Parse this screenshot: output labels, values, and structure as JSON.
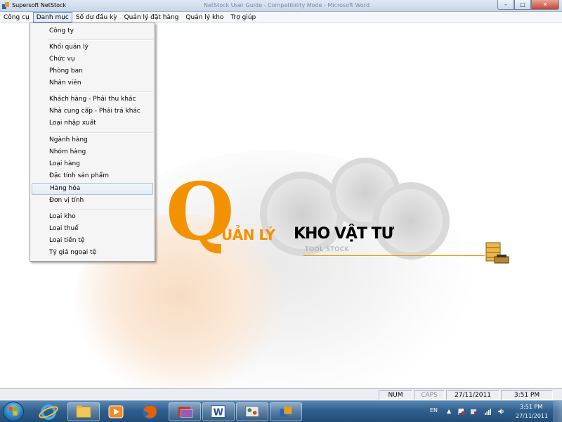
{
  "window": {
    "title": "Supersoft NetStock",
    "ghost_title": "NetStock User Guide - Compatibility Mode - Microsoft Word",
    "minimize_glyph": "–",
    "maximize_glyph": "□",
    "close_glyph": "✕"
  },
  "menubar": {
    "items": [
      "Công cụ",
      "Danh mục",
      "Số dư đầu kỳ",
      "Quản lý đặt hàng",
      "Quản lý kho",
      "Trợ giúp"
    ],
    "active_index": 1
  },
  "dropdown": {
    "items": [
      "Công ty",
      "Khối quản lý",
      "Chức vụ",
      "Phòng ban",
      "Nhân viên",
      "Khách hàng - Phải thu khác",
      "Nhà cung cấp - Phải trả khác",
      "Loại nhập xuất",
      "Ngành hàng",
      "Nhóm hàng",
      "Loại hàng",
      "Đặc tính sản phẩm",
      "Hàng hóa",
      "Đơn vị tính",
      "Loại kho",
      "Loại thuế",
      "Loại tiền tệ",
      "Tỷ giá ngoại tệ"
    ],
    "highlighted_index": 12
  },
  "splash": {
    "logo_letter": "Q",
    "logo_rest": "UẢN LÝ",
    "logo_product": "KHO VẬT TƯ",
    "logo_subtitle": "TOOL STOCK",
    "accent_color": "#f39200"
  },
  "statusbar": {
    "num": "NUM",
    "caps": "CAPS",
    "date": "27/11/2011",
    "time": "3:51 PM"
  },
  "taskbar": {
    "pinned": [
      "internet-explorer-icon",
      "file-explorer-icon",
      "media-player-icon",
      "firefox-icon",
      "app-icon",
      "word-icon",
      "paint-icon",
      "netstock-icon"
    ],
    "tray_lang": "EN",
    "tray_time": "3:51 PM",
    "tray_date": "27/11/2011"
  }
}
